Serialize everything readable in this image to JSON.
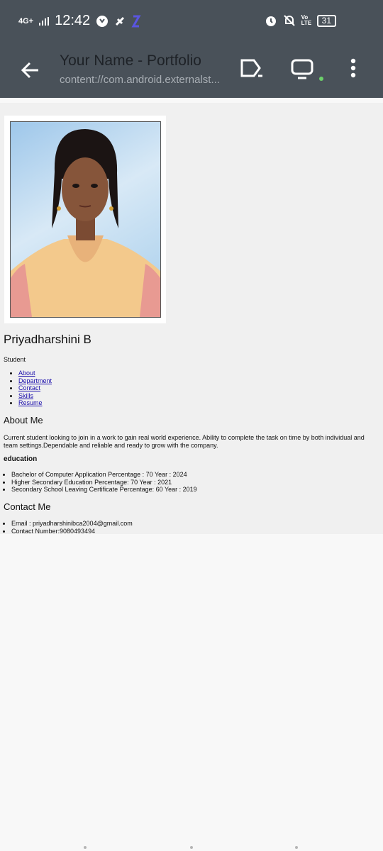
{
  "status_bar": {
    "network": "4G+",
    "time": "12:42",
    "battery": "31",
    "volte": "Vo LTE"
  },
  "app_bar": {
    "title": "Your Name - Portfolio",
    "url": "content://com.android.externalst..."
  },
  "page": {
    "name": "Priyadharshini B",
    "role": "Student",
    "nav": [
      "About",
      "Department",
      "Contact",
      "Skills",
      "Resume"
    ],
    "about_heading": "About Me",
    "about_text": "Current student looking to join in a work to gain real world experience. Ability to complete the task on time by both individual and team settings.Dependable and reliable and ready to grow with the company.",
    "education_heading": "education",
    "education": [
      "Bachelor of Computer Application Percentage   : 70 Year :  2024",
      "Higher Secondary Education Percentage:  70 Year :  2021",
      "Secondary School Leaving Certificate Percentage: 60 Year :  2019"
    ],
    "contact_heading": "Contact Me",
    "contact": [
      "Email : priyadharshinibca2004@gmail.com",
      "Contact Number:9080493494"
    ]
  },
  "colors": {
    "toolbar": "#495159",
    "page_bg": "#f0f0f0",
    "link": "#1a0dab",
    "indicator": "#6cd06a"
  }
}
